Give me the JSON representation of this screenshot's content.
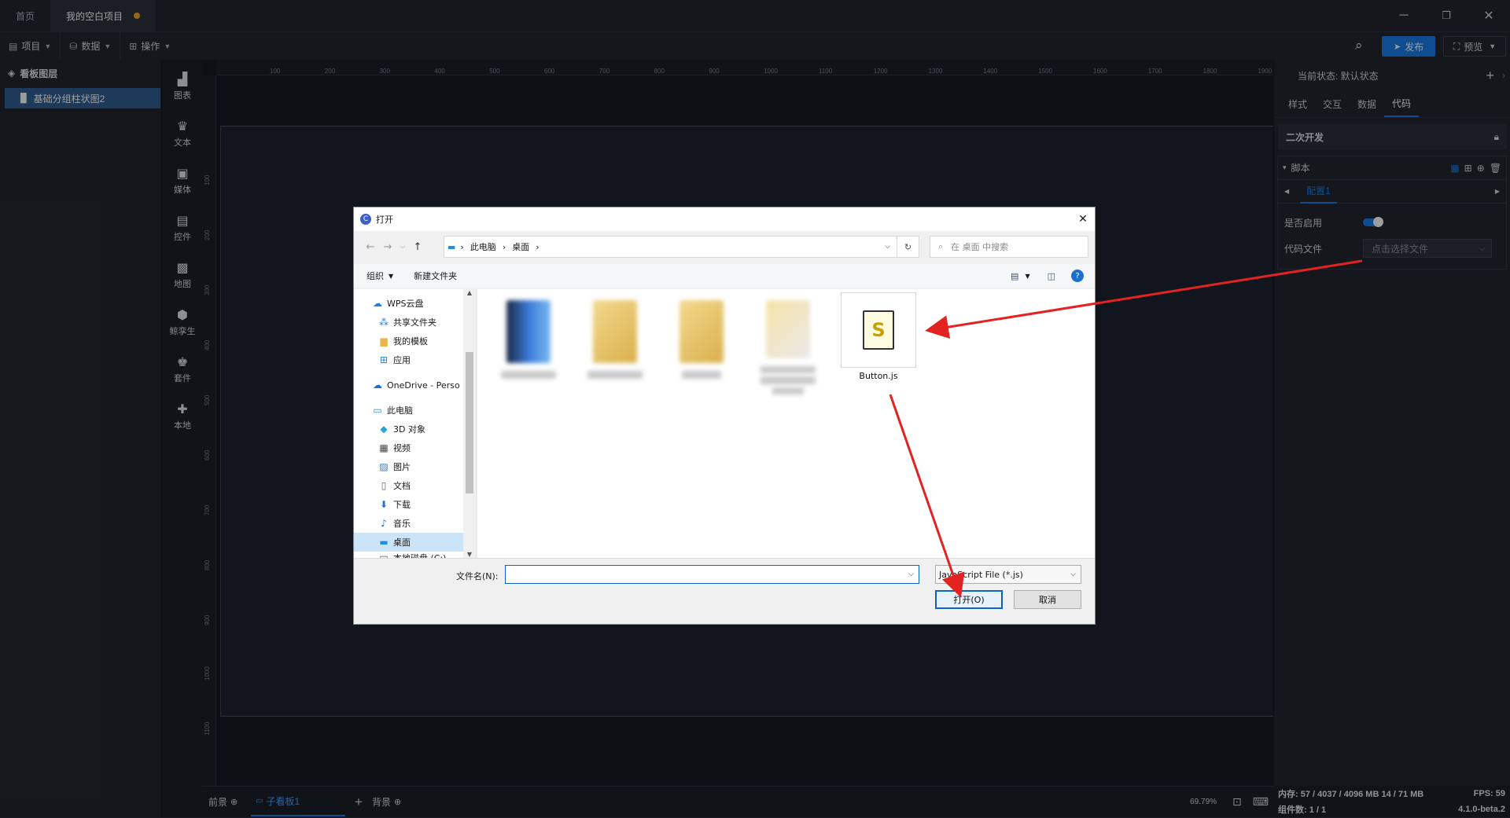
{
  "tabs": [
    {
      "label": "首页",
      "active": false
    },
    {
      "label": "我的空白项目",
      "active": true,
      "unsaved": true
    }
  ],
  "toolbar": {
    "project": "项目",
    "data": "数据",
    "operate": "操作",
    "publish": "发布",
    "preview": "预览"
  },
  "layers": {
    "title": "看板图层",
    "items": [
      "基础分组柱状图2"
    ]
  },
  "components": [
    "图表",
    "文本",
    "媒体",
    "控件",
    "地图",
    "鲸孪生",
    "套件",
    "本地"
  ],
  "ruler": {
    "h_ticks": [
      "100",
      "200",
      "300",
      "400",
      "500",
      "600",
      "700",
      "800",
      "900",
      "1000",
      "1100",
      "1200",
      "1300",
      "1400",
      "1500",
      "1600",
      "1700",
      "1800",
      "1900"
    ],
    "v_ticks": [
      "100",
      "200",
      "300",
      "400",
      "500",
      "600",
      "700",
      "800",
      "900",
      "1000",
      "1100"
    ]
  },
  "right_panel": {
    "state_label": "当前状态: 默认状态",
    "tabs": [
      "样式",
      "交互",
      "数据",
      "代码"
    ],
    "active_tab": "代码",
    "section": "二次开发",
    "script_group": "脚本",
    "config_tab": "配置1",
    "enable_label": "是否启用",
    "enabled": true,
    "code_file_label": "代码文件",
    "code_file_placeholder": "点击选择文件"
  },
  "bottom": {
    "foreground": "前景",
    "sub_board": "子看板1",
    "background": "背景",
    "zoom": "69.79%"
  },
  "status": {
    "memory": "内存: 57 / 4037 / 4096 MB 14 / 71 MB",
    "fps": "FPS: 59",
    "components": "组件数: 1 / 1",
    "version": "4.1.0-beta.2"
  },
  "dialog": {
    "title": "打开",
    "breadcrumb": [
      "此电脑",
      "桌面"
    ],
    "search_placeholder": "在 桌面 中搜索",
    "organize": "组织",
    "new_folder": "新建文件夹",
    "nav_items": [
      {
        "label": "WPS云盘",
        "icon": "cloud-icon"
      },
      {
        "label": "共享文件夹",
        "icon": "share-icon"
      },
      {
        "label": "我的模板",
        "icon": "folder-icon"
      },
      {
        "label": "应用",
        "icon": "apps-icon"
      },
      {
        "label": "OneDrive - Perso",
        "icon": "onedrive-icon"
      },
      {
        "label": "此电脑",
        "icon": "computer-icon"
      },
      {
        "label": "3D 对象",
        "icon": "cube-icon"
      },
      {
        "label": "视频",
        "icon": "video-icon"
      },
      {
        "label": "图片",
        "icon": "picture-icon"
      },
      {
        "label": "文档",
        "icon": "document-icon"
      },
      {
        "label": "下载",
        "icon": "download-icon"
      },
      {
        "label": "音乐",
        "icon": "music-icon"
      },
      {
        "label": "桌面",
        "icon": "desktop-icon",
        "selected": true
      },
      {
        "label": "本地磁盘 (C:)",
        "icon": "disk-icon"
      }
    ],
    "file": "Button.js",
    "filename_label": "文件名(N):",
    "filename_value": "",
    "filetype": "JavaScript File (*.js)",
    "open_button": "打开(O)",
    "cancel_button": "取消"
  }
}
